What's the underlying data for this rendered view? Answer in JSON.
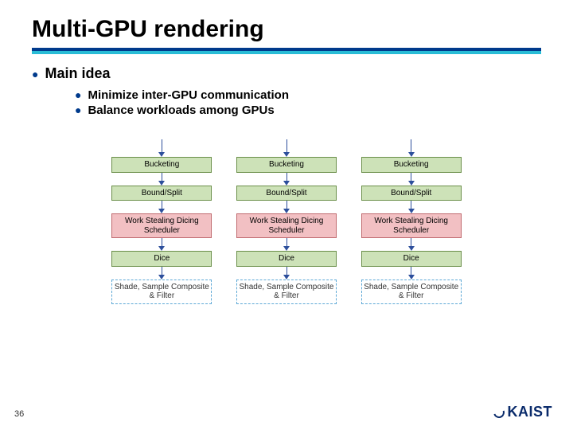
{
  "title": "Multi-GPU rendering",
  "main_heading": "Main idea",
  "sub_items": [
    "Minimize inter-GPU communication",
    "Balance workloads among GPUs"
  ],
  "pipeline_stages": [
    {
      "label": "Bucketing",
      "style": "green"
    },
    {
      "label": "Bound/Split",
      "style": "green"
    },
    {
      "label": "Work Stealing Dicing Scheduler",
      "style": "pink"
    },
    {
      "label": "Dice",
      "style": "green"
    },
    {
      "label": "Shade, Sample Composite & Filter",
      "style": "blue"
    }
  ],
  "pipeline_columns": 3,
  "page_number": "36",
  "logo_text": "KAIST"
}
